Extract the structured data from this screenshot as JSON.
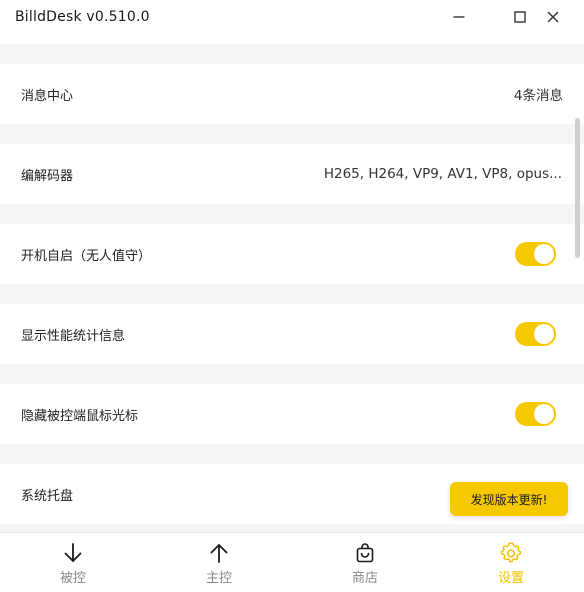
{
  "window": {
    "title": "BilldDesk v0.510.0"
  },
  "settings": {
    "rows": [
      {
        "label": "消息中心",
        "value": "4条消息"
      },
      {
        "label": "编解码器",
        "value": "H265, H264, VP9, AV1, VP8, opus..."
      },
      {
        "label": "开机自启（无人值守）",
        "toggle": true
      },
      {
        "label": "显示性能统计信息",
        "toggle": true
      },
      {
        "label": "隐藏被控端鼠标光标",
        "toggle": true
      },
      {
        "label": "系统托盘",
        "toggle": true
      }
    ]
  },
  "toast": {
    "text": "发现版本更新!"
  },
  "nav": {
    "items": [
      {
        "label": "被控",
        "icon": "arrow-down-icon",
        "active": false
      },
      {
        "label": "主控",
        "icon": "arrow-up-icon",
        "active": false
      },
      {
        "label": "商店",
        "icon": "shopping-bag-icon",
        "active": false
      },
      {
        "label": "设置",
        "icon": "gear-icon",
        "active": true
      }
    ]
  },
  "colors": {
    "accent": "#f6c800",
    "active_nav": "#f2c200",
    "inactive_nav": "#8a8a8a",
    "background": "#f5f5f5"
  }
}
